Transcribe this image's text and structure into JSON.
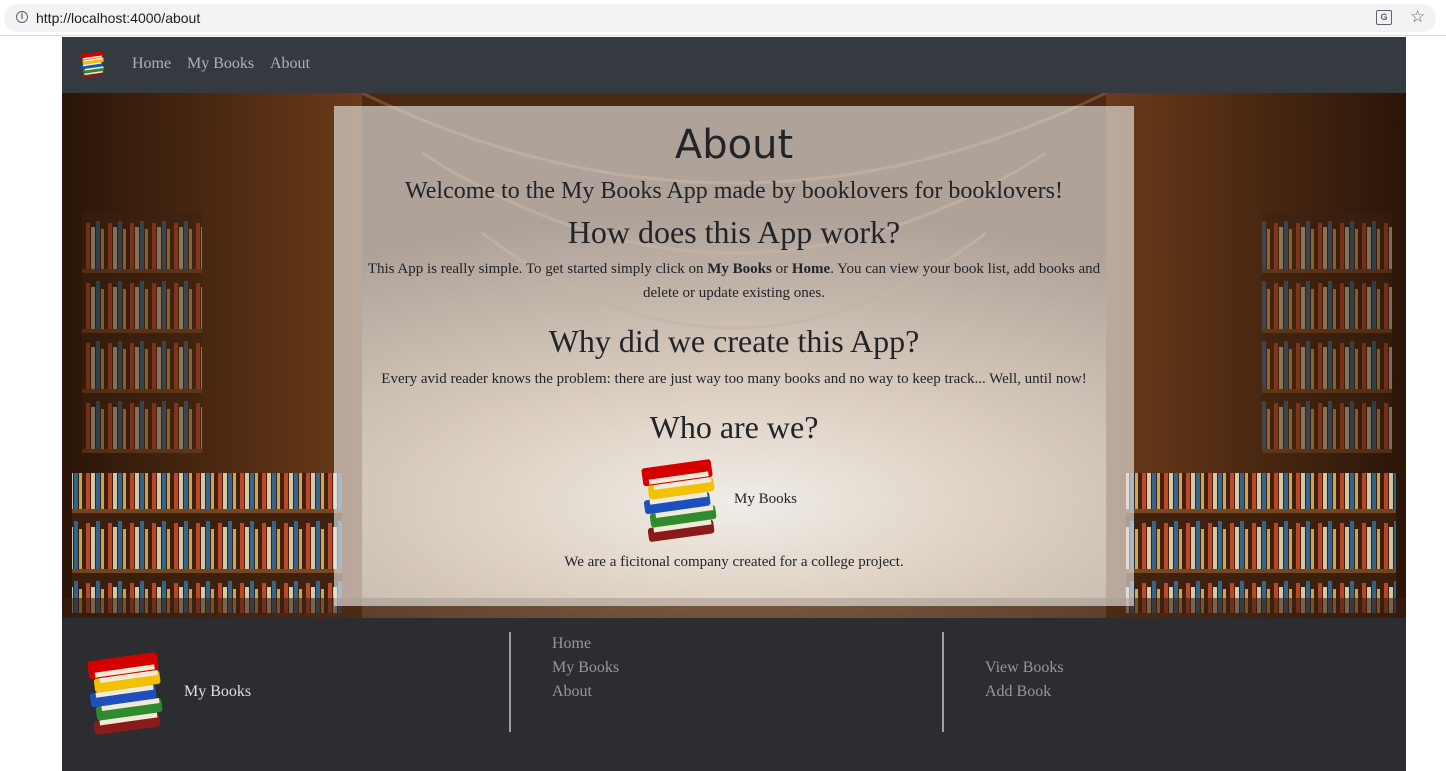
{
  "browser": {
    "url": "http://localhost:4000/about",
    "info_icon": "info-icon",
    "translate_icon": "translate-icon",
    "bookmark_icon": "star-icon"
  },
  "navbar": {
    "logo_icon": "books-stack-icon",
    "links": [
      "Home",
      "My Books",
      "About"
    ]
  },
  "about": {
    "title": "About",
    "welcome": "Welcome to the My Books App made by booklovers for booklovers!",
    "how_heading": "How does this App work?",
    "how_text_1": "This App is really simple. To get started simply click on ",
    "how_bold_1": "My Books",
    "how_text_2": " or ",
    "how_bold_2": "Home",
    "how_text_3": ". You can view your book list, add books and delete or update existing ones.",
    "why_heading": "Why did we create this App?",
    "why_text": "Every avid reader knows the problem: there are just way too many books and no way to keep track... Well, until now!",
    "who_heading": "Who are we?",
    "who_brand": "My Books",
    "who_text": "We are a ficitonal company created for a college project."
  },
  "footer": {
    "brand": "My Books",
    "nav_links": [
      "Home",
      "My Books",
      "About"
    ],
    "book_links": [
      "View Books",
      "Add Book"
    ]
  },
  "colors": {
    "navbar_bg": "#343a40",
    "footer_bg": "#2b2d31",
    "panel_bg": "rgba(235,235,235,0.62)"
  }
}
